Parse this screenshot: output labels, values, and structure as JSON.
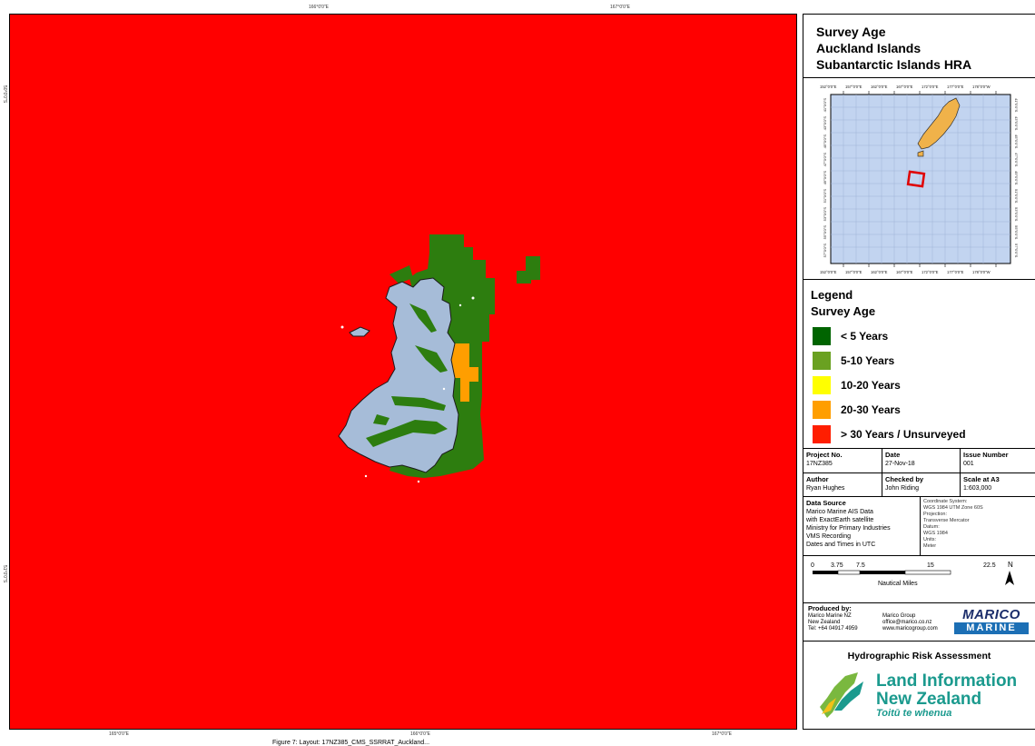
{
  "map": {
    "top_ticks": [
      "166°0'0\"E",
      "167°0'0\"E"
    ],
    "bottom_ticks": [
      "165°0'0\"E",
      "166°0'0\"E",
      "167°0'0\"E"
    ],
    "left_ticks": [
      "50°0'0\"S",
      "51°0'0\"S"
    ],
    "caption": "Figure 7: Layout: 17NZ385_CMS_SSRRAT_Auckland..."
  },
  "title": {
    "line1": "Survey Age",
    "line2": "Auckland Islands",
    "line3": "Subantarctic Islands HRA"
  },
  "inset": {
    "top_labels": [
      "152°0'0\"E",
      "157°0'0\"E",
      "162°0'0\"E",
      "167°0'0\"E",
      "172°0'0\"E",
      "177°0'0\"E",
      "178°0'0\"W"
    ],
    "bottom_labels": [
      "152°0'0\"E",
      "157°0'0\"E",
      "162°0'0\"E",
      "167°0'0\"E",
      "172°0'0\"E",
      "177°0'0\"E",
      "178°0'0\"W"
    ],
    "side_labels": [
      "41°0'0\"S",
      "43°0'0\"S",
      "45°0'0\"S",
      "47°0'0\"S",
      "49°0'0\"S",
      "51°0'0\"S",
      "53°0'0\"S",
      "55°0'0\"S",
      "57°0'0\"S"
    ]
  },
  "legend": {
    "title": "Legend",
    "subtitle": "Survey Age",
    "items": [
      {
        "label": "< 5 Years",
        "color": "#006400"
      },
      {
        "label": "5-10 Years",
        "color": "#6aa121"
      },
      {
        "label": "10-20 Years",
        "color": "#ffff00"
      },
      {
        "label": "20-30 Years",
        "color": "#ff9e00"
      },
      {
        "label": "> 30 Years / Unsurveyed",
        "color": "#ff1e00"
      }
    ]
  },
  "colors": {
    "sea_unsurveyed": "#ff0000",
    "under_5": "#2d7d0f",
    "years_20_30": "#ff9e00",
    "land": "#a6bcd8",
    "inset_sea": "#c2d4f0",
    "inset_land": "#f0b24a",
    "inset_box": "#e00000"
  },
  "info": {
    "project_no_label": "Project No.",
    "project_no": "17NZ385",
    "date_label": "Date",
    "date": "27-Nov-18",
    "issue_label": "Issue Number",
    "issue": "001",
    "author_label": "Author",
    "author": "Ryan Hughes",
    "checked_label": "Checked by",
    "checked": "John Riding",
    "scale_label": "Scale at A3",
    "scale": "1:603,000",
    "data_source_label": "Data Source",
    "data_source_lines": [
      "Marico Marine AIS Data",
      "with ExactEarth satellite",
      "Ministry for Primary Industries",
      "VMS Recording",
      "Dates and Times in UTC"
    ],
    "coord_lines": [
      "Coordinate System:",
      "WGS 1984 UTM Zone 60S",
      "Projection:",
      "Transverse Mercator",
      "Datum:",
      "WGS 1984",
      "Units:",
      "Meter"
    ]
  },
  "scalebar": {
    "ticks": [
      "0",
      "3.75",
      "7.5",
      "15",
      "22.5"
    ],
    "unit": "Nautical Miles",
    "north": "N"
  },
  "produced": {
    "label": "Produced by:",
    "col1": [
      "Marico Marine NZ",
      "New Zealand",
      "Tel: +64 04917 4959"
    ],
    "col2": [
      "Marico Group",
      "office@marico.co.nz",
      "www.maricogroup.com"
    ],
    "logo_top": "MARICO",
    "logo_bottom": "MARINE"
  },
  "footer": {
    "hra_title": "Hydrographic Risk Assessment",
    "linz_line1": "Land Information",
    "linz_line2": "New Zealand",
    "linz_line3": "Toitū te whenua"
  }
}
